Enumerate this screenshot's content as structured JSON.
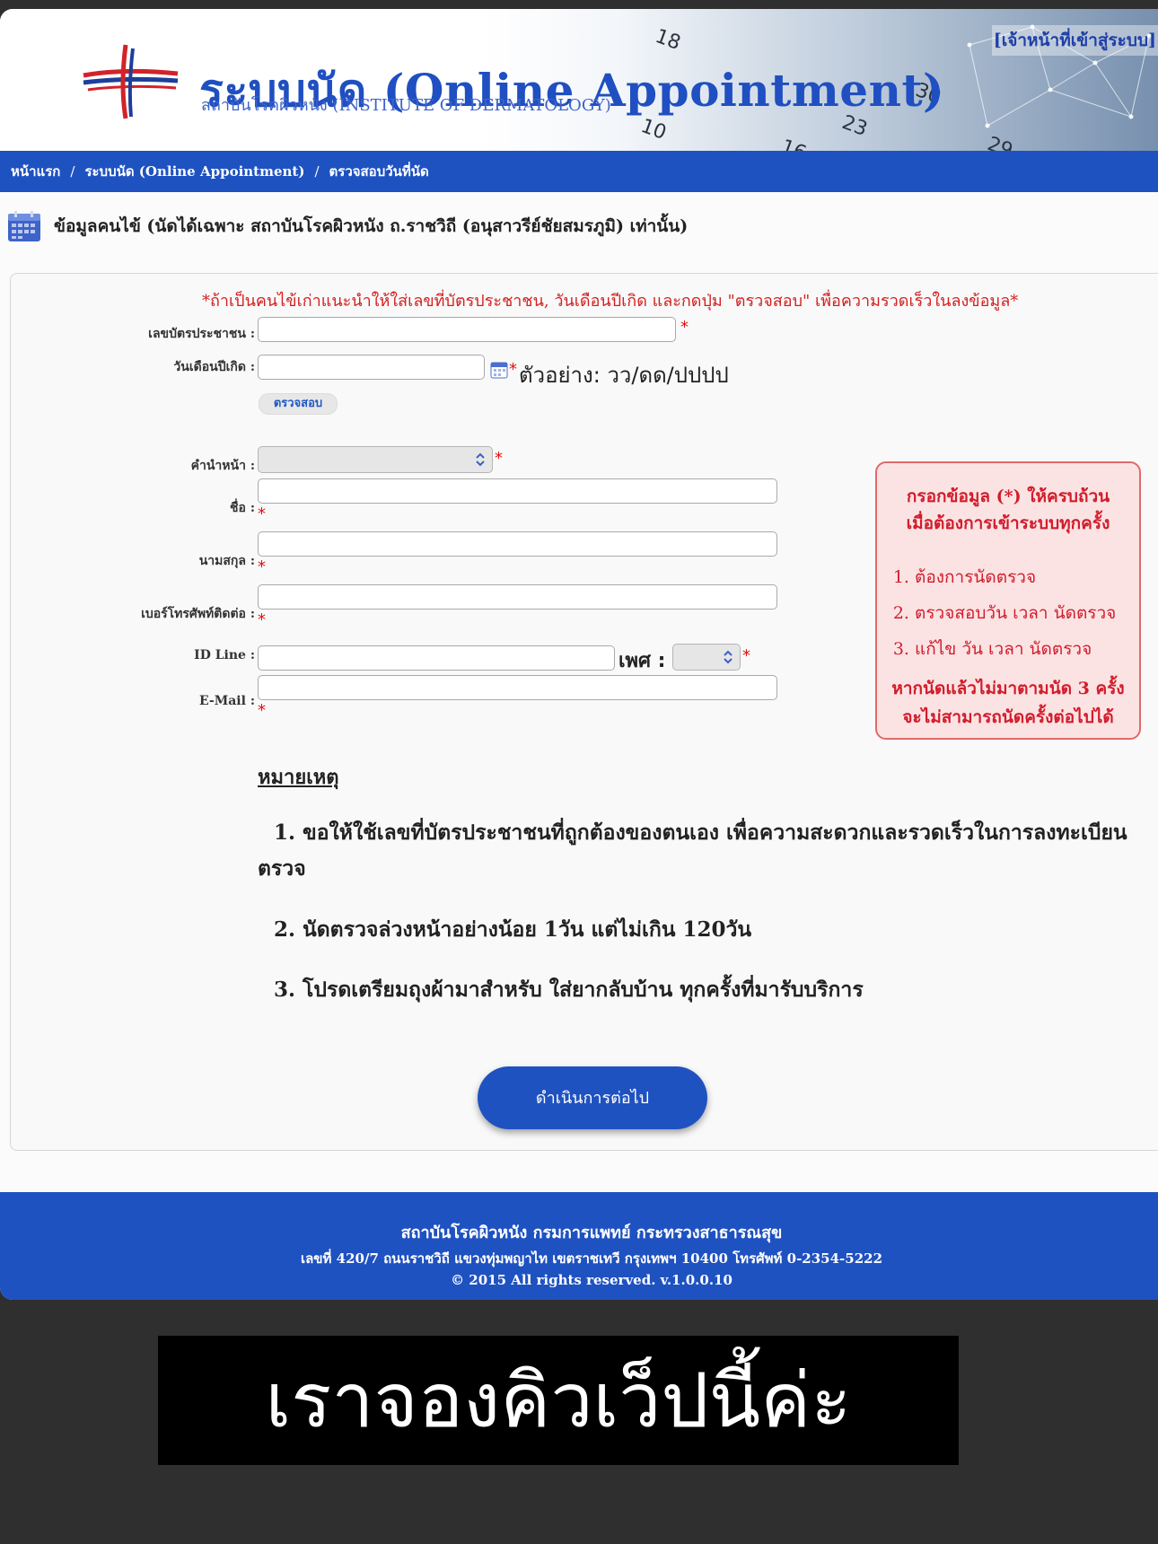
{
  "header": {
    "title": "ระบบนัด (Online Appointment)",
    "subtitle": "สถาบันโรคผิวหนัง (INSTITUTE OF DERMATOLOGY)",
    "staff_login": "[เจ้าหน้าที่เข้าสู่ระบบ]",
    "calendar_numbers": [
      "18",
      "30",
      "10",
      "23",
      "16",
      "29"
    ]
  },
  "breadcrumb": {
    "home": "หน้าแรก",
    "system": "ระบบนัด (Online Appointment)",
    "current": "ตรวจสอบวันที่นัด",
    "separator": "/"
  },
  "section": {
    "title": "ข้อมูลคนไข้ (นัดได้เฉพาะ สถาบันโรคผิวหนัง ถ.ราชวิถี (อนุสาวรีย์ชัยสมรภูมิ) เท่านั้น)"
  },
  "form": {
    "notice": "*ถ้าเป็นคนไข้เก่าแนะนำให้ใส่เลขที่บัตรประชาชน, วันเดือนปีเกิด และกดปุ่ม \"ตรวจสอบ\" เพื่อความรวดเร็วในลงข้อมูล*",
    "required_mark": "*",
    "id_card_label": "เลขบัตรประชาชน :",
    "id_card_value": "",
    "birth_label": "วันเดือนปีเกิด :",
    "birth_value": "",
    "birth_example": "ตัวอย่าง: วว/ดด/ปปปป",
    "check_button": "ตรวจสอบ",
    "prefix_label": "คำนำหน้า :",
    "prefix_value": "",
    "first_name_label": "ชื่อ :",
    "first_name_value": "",
    "last_name_label": "นามสกุล :",
    "last_name_value": "",
    "phone_label": "เบอร์โทรศัพท์ติดต่อ :",
    "phone_value": "",
    "line_label": "ID Line :",
    "line_value": "",
    "gender_label": "เพศ :",
    "gender_value": "",
    "email_label": "E-Mail :",
    "email_value": ""
  },
  "infobox": {
    "heading_1": "กรอกข้อมูล (*) ให้ครบถ้วน",
    "heading_2": "เมื่อต้องการเข้าระบบทุกครั้ง",
    "items": [
      "ต้องการนัดตรวจ",
      "ตรวจสอบวัน เวลา นัดตรวจ",
      "แก้ไข วัน เวลา นัดตรวจ"
    ],
    "warning_1": "หากนัดแล้วไม่มาตามนัด 3 ครั้ง",
    "warning_2": "จะไม่สามารถนัดครั้งต่อไปได้"
  },
  "remarks": {
    "title": "หมายเหตุ",
    "item_1": "1. ขอให้ใช้เลขที่บัตรประชาชนที่ถูกต้องของตนเอง เพื่อความสะดวกและรวดเร็วในการลงทะเบียนตรวจ",
    "item_2": "2. นัดตรวจล่วงหน้าอย่างน้อย 1วัน แต่ไม่เกิน 120วัน",
    "item_3": "3. โปรดเตรียมถุงผ้ามาสำหรับ ใส่ยากลับบ้าน ทุกครั้งที่มารับบริการ"
  },
  "proceed_button": "ดำเนินการต่อไป",
  "footer": {
    "line_1": "สถาบันโรคผิวหนัง กรมการแพทย์ กระทรวงสาธารณสุข",
    "line_2": "เลขที่ 420/7 ถนนราชวิถี แขวงทุ่มพญาไท เขตราชเทวี กรุงเทพฯ 10400 โทรศัพท์ 0-2354-5222",
    "line_3": "© 2015 All rights reserved. v.1.0.0.10"
  },
  "caption": "เราจองคิวเว็ปนี้ค่ะ",
  "colors": {
    "brand_blue": "#1f52c1",
    "required_red": "#e01010",
    "info_bg": "#fbe3e3"
  }
}
